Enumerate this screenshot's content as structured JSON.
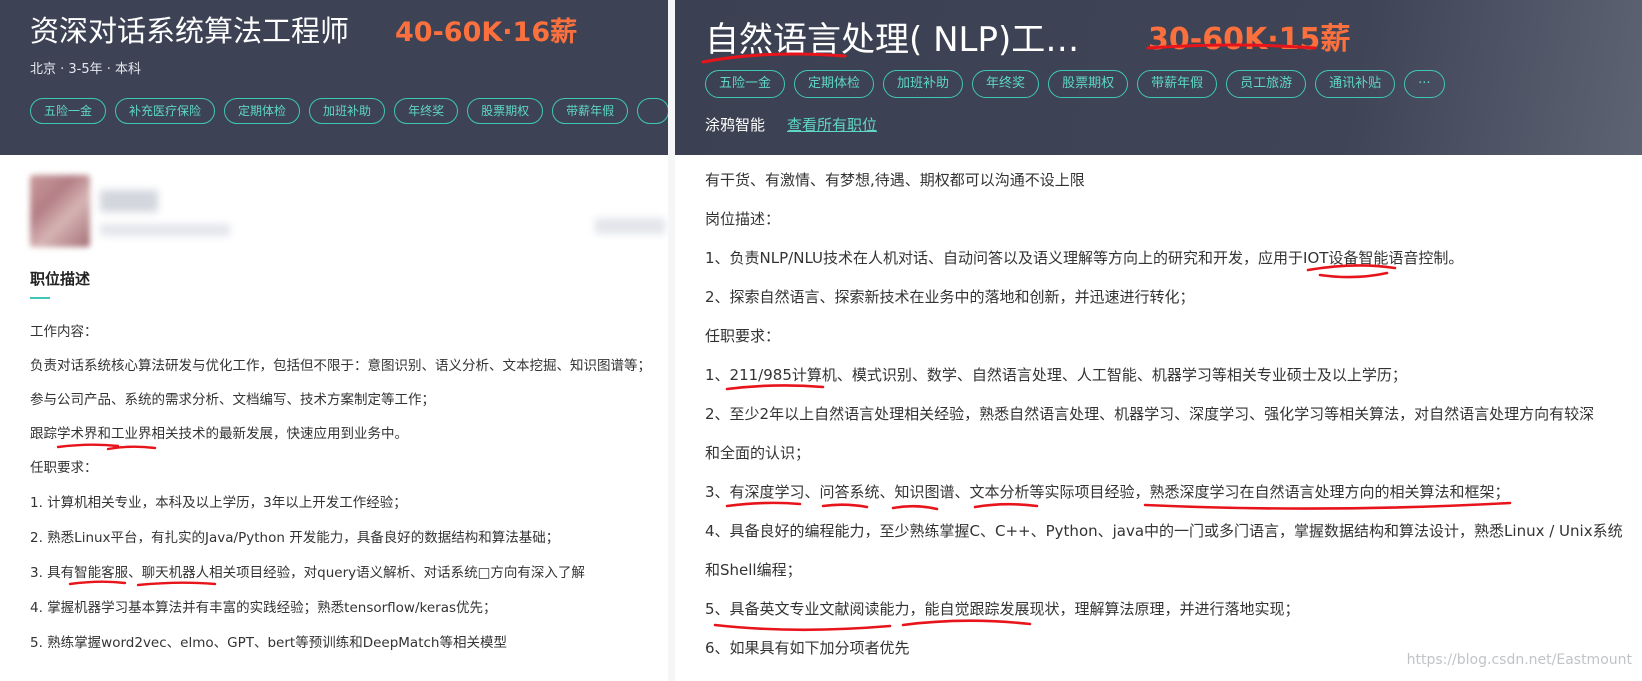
{
  "left": {
    "title": "资深对话系统算法工程师",
    "salary": "40-60K·16薪",
    "meta": "北京 · 3-5年 · 本科",
    "tags": [
      "五险一金",
      "补充医疗保险",
      "定期体检",
      "加班补助",
      "年终奖",
      "股票期权",
      "带薪年假"
    ],
    "section_title": "职位描述",
    "lines": [
      "工作内容：",
      "负责对话系统核心算法研发与优化工作，包括但不限于：意图识别、语义分析、文本挖掘、知识图谱等；",
      "参与公司产品、系统的需求分析、文档编写、技术方案制定等工作；",
      "跟踪学术界和工业界相关技术的最新发展，快速应用到业务中。",
      "任职要求：",
      "1. 计算机相关专业，本科及以上学历，3年以上开发工作经验；",
      "2. 熟悉Linux平台，有扎实的Java/Python 开发能力，具备良好的数据结构和算法基础；",
      "3. 具有智能客服、聊天机器人相关项目经验，对query语义解析、对话系统□方向有深入了解",
      "4. 掌握机器学习基本算法并有丰富的实践经验；熟悉tensorflow/keras优先；",
      "5. 熟练掌握word2vec、elmo、GPT、bert等预训练和DeepMatch等相关模型"
    ]
  },
  "right": {
    "title": "自然语言处理( NLP)工…",
    "salary": "30-60K·15薪",
    "tags": [
      "五险一金",
      "定期体检",
      "加班补助",
      "年终奖",
      "股票期权",
      "带薪年假",
      "员工旅游",
      "通讯补贴",
      "···"
    ],
    "company": "涂鸦智能",
    "all_jobs_link": "查看所有职位",
    "lines": [
      "有干货、有激情、有梦想,待遇、期权都可以沟通不设上限",
      "岗位描述：",
      "1、负责NLP/NLU技术在人机对话、自动问答以及语义理解等方向上的研究和开发，应用于IOT设备智能语音控制。",
      "2、探索自然语言、探索新技术在业务中的落地和创新，并迅速进行转化；",
      "任职要求：",
      "1、211/985计算机、模式识别、数学、自然语言处理、人工智能、机器学习等相关专业硕士及以上学历；",
      "2、至少2年以上自然语言处理相关经验，熟悉自然语言处理、机器学习、深度学习、强化学习等相关算法，对自然语言处理方向有较深",
      "和全面的认识；",
      "3、有深度学习、问答系统、知识图谱、文本分析等实际项目经验，熟悉深度学习在自然语言处理方向的相关算法和框架；",
      "4、具备良好的编程能力，至少熟练掌握C、C++、Python、java中的一门或多门语言，掌握数据结构和算法设计，熟悉Linux / Unix系统",
      "和Shell编程；",
      "5、具备英文专业文献阅读能力，能自觉跟踪发展现状，理解算法原理，并进行落地实现；",
      "6、如果具有如下加分项者优先"
    ]
  },
  "watermark": "https://blog.csdn.net/Eastmount",
  "colors": {
    "header_bg": "#3d4355",
    "salary": "#fc703e",
    "tag": "#3fc7b5",
    "annotation": "#e8141b"
  }
}
